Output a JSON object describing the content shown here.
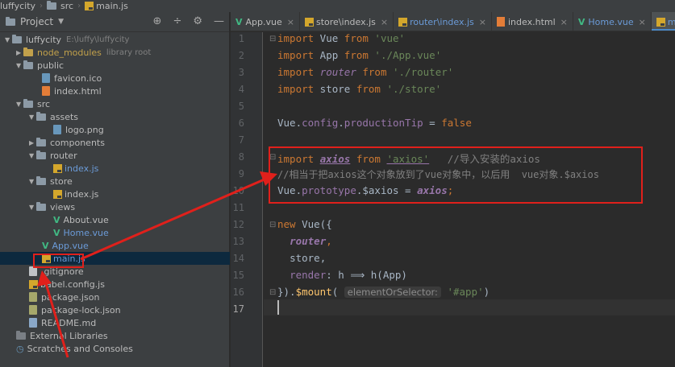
{
  "breadcrumb": [
    "luffycity",
    "src",
    "main.js"
  ],
  "project_panel": {
    "title": "Project",
    "tree": [
      {
        "label": "luffycity",
        "sub": "E:\\luffy\\luffycity",
        "kind": "root"
      },
      {
        "label": "node_modules",
        "sub": "library root",
        "kind": "node_modules"
      },
      {
        "label": "public",
        "kind": "folder"
      },
      {
        "label": "favicon.ico",
        "kind": "file"
      },
      {
        "label": "index.html",
        "kind": "file"
      },
      {
        "label": "src",
        "kind": "folder"
      },
      {
        "label": "assets",
        "kind": "folder"
      },
      {
        "label": "logo.png",
        "kind": "file"
      },
      {
        "label": "components",
        "kind": "folder"
      },
      {
        "label": "router",
        "kind": "folder"
      },
      {
        "label": "index.js",
        "kind": "file"
      },
      {
        "label": "store",
        "kind": "folder"
      },
      {
        "label": "index.js",
        "kind": "file"
      },
      {
        "label": "views",
        "kind": "folder"
      },
      {
        "label": "About.vue",
        "kind": "vue"
      },
      {
        "label": "Home.vue",
        "kind": "vue"
      },
      {
        "label": "App.vue",
        "kind": "vue"
      },
      {
        "label": "main.js",
        "kind": "file",
        "selected": true
      },
      {
        "label": ".gitignore",
        "kind": "file"
      },
      {
        "label": "babel.config.js",
        "kind": "file"
      },
      {
        "label": "package.json",
        "kind": "file"
      },
      {
        "label": "package-lock.json",
        "kind": "file"
      },
      {
        "label": "README.md",
        "kind": "file"
      },
      {
        "label": "External Libraries",
        "kind": "library"
      },
      {
        "label": "Scratches and Consoles",
        "kind": "scratch"
      }
    ]
  },
  "tabs": [
    {
      "label": "App.vue",
      "kind": "vue"
    },
    {
      "label": "store\\index.js",
      "kind": "js"
    },
    {
      "label": "router\\index.js",
      "kind": "js"
    },
    {
      "label": "index.html",
      "kind": "html"
    },
    {
      "label": "Home.vue",
      "kind": "vue"
    },
    {
      "label": "main.js",
      "kind": "js",
      "active": true
    }
  ],
  "editor": {
    "line_numbers": [
      "1",
      "2",
      "3",
      "4",
      "5",
      "6",
      "7",
      "8",
      "9",
      "10",
      "11",
      "12",
      "13",
      "14",
      "15",
      "16",
      "17"
    ],
    "current_line": "17",
    "code": {
      "l1": {
        "kw": "import",
        "name": " Vue ",
        "from": "from",
        "str": " 'vue'"
      },
      "l2": {
        "kw": "import",
        "name": " App ",
        "from": "from",
        "str": " './App.vue'"
      },
      "l3": {
        "kw": "import",
        "name": "router",
        "from": "from",
        "str": " './router'"
      },
      "l4": {
        "kw": "import",
        "name": " store ",
        "from": "from",
        "str": " './store'"
      },
      "l6": {
        "obj": "Vue.",
        "p1": "config",
        "dot": ".",
        "p2": "productionTip",
        "eq": " = ",
        "val": "false"
      },
      "l8": {
        "kw": "import",
        "name": "axios",
        "from": "from",
        "str": "'axios'",
        "comment": "//导入安装的axios"
      },
      "l9": {
        "comment": "//相当于把axios这个对象放到了vue对象中，以后用  vue对象.$axios"
      },
      "l10": {
        "obj": "Vue.",
        "p1": "prototype",
        "dot": ".$axios = ",
        "val": "axios",
        "semi": ";"
      },
      "l12": {
        "kw": "new",
        "rest": " Vue({"
      },
      "l13": {
        "prop": "router",
        "comma": ","
      },
      "l14": {
        "text": "store,"
      },
      "l15": {
        "prop": "render",
        "rest": ": h ⟹ h(App)"
      },
      "l16": {
        "pre": "}).",
        "method": "$mount",
        "open": "(",
        "hint": "elementOrSelector:",
        "str": "'#app'",
        "close": ")"
      }
    }
  },
  "colors": {
    "annotation": "#e0201b",
    "accent": "#4a88c7"
  }
}
